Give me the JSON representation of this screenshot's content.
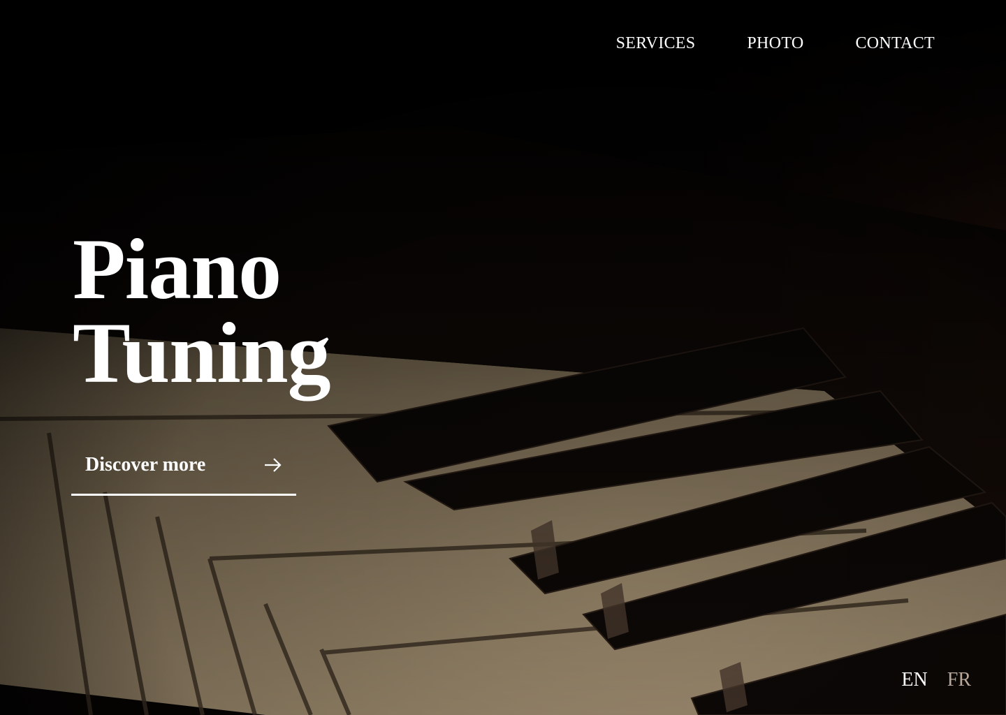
{
  "nav": {
    "items": [
      {
        "label": "SERVICES"
      },
      {
        "label": "PHOTO"
      },
      {
        "label": "CONTACT"
      }
    ]
  },
  "hero": {
    "title_line1": "Piano",
    "title_line2": "Tuning",
    "cta_label": "Discover more",
    "cta_icon": "arrow-right-icon",
    "background": "dark piano keyboard photo"
  },
  "language": {
    "options": [
      {
        "label": "EN",
        "active": true
      },
      {
        "label": "FR",
        "active": false
      }
    ]
  },
  "colors": {
    "background": "#050302",
    "text": "#ffffff",
    "inactive_language": "#b6a79a",
    "key_ivory": "#8b7a5e",
    "key_black": "#0e0908"
  }
}
